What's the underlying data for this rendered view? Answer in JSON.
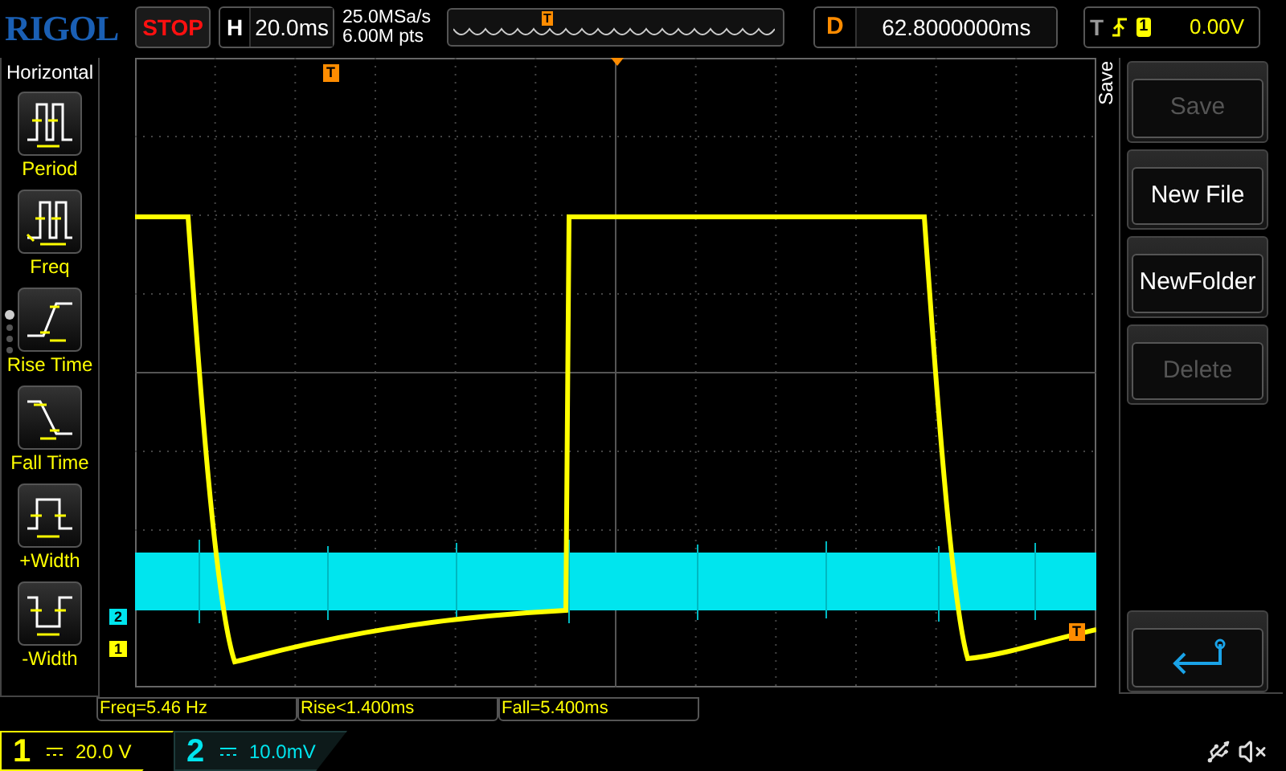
{
  "header": {
    "logo": "RIGOL",
    "run_state": "STOP",
    "timebase": {
      "label": "H",
      "value": "20.0ms"
    },
    "sample_rate": "25.0MSa/s",
    "memory_depth": "6.00M pts",
    "trigger_position_marker": "T",
    "delay": {
      "label": "D",
      "value": "62.8000000ms"
    },
    "trigger": {
      "label": "T",
      "source": "1",
      "level": "0.00V"
    }
  },
  "left_menu": {
    "title": "Horizontal",
    "items": [
      {
        "kind": "period",
        "label": "Period"
      },
      {
        "kind": "freq",
        "label": "Freq"
      },
      {
        "kind": "rise",
        "label": "Rise Time"
      },
      {
        "kind": "fall",
        "label": "Fall Time"
      },
      {
        "kind": "pwidth",
        "label": "+Width"
      },
      {
        "kind": "nwidth",
        "label": "-Width"
      }
    ],
    "pages": [
      {
        "selected": true
      },
      {
        "selected": false
      },
      {
        "selected": false
      },
      {
        "selected": false
      }
    ]
  },
  "graticule": {
    "trigger_marker": "T",
    "level_markers": [
      {
        "label": "2",
        "color": "#00e5ee"
      },
      {
        "label": "1",
        "color": "#ffff00"
      }
    ],
    "trigger_level_marker": "T"
  },
  "right_menu": {
    "title": "Save",
    "buttons": [
      {
        "kind": "text",
        "label": "Save",
        "disabled": true
      },
      {
        "kind": "text",
        "label": "New File",
        "disabled": false
      },
      {
        "kind": "text",
        "label": "NewFolder",
        "disabled": false
      },
      {
        "kind": "text",
        "label": "Delete",
        "disabled": true
      },
      {
        "kind": "return",
        "disabled": false
      }
    ]
  },
  "measurements": [
    "Freq=5.46 Hz",
    "Rise<1.400ms",
    "Fall=5.400ms"
  ],
  "channels": [
    {
      "number": "1",
      "scale": "20.0 V",
      "color": "#ffff00",
      "selected": true
    },
    {
      "number": "2",
      "scale": "10.0mV",
      "color": "#00e5ee",
      "selected": false
    }
  ]
}
